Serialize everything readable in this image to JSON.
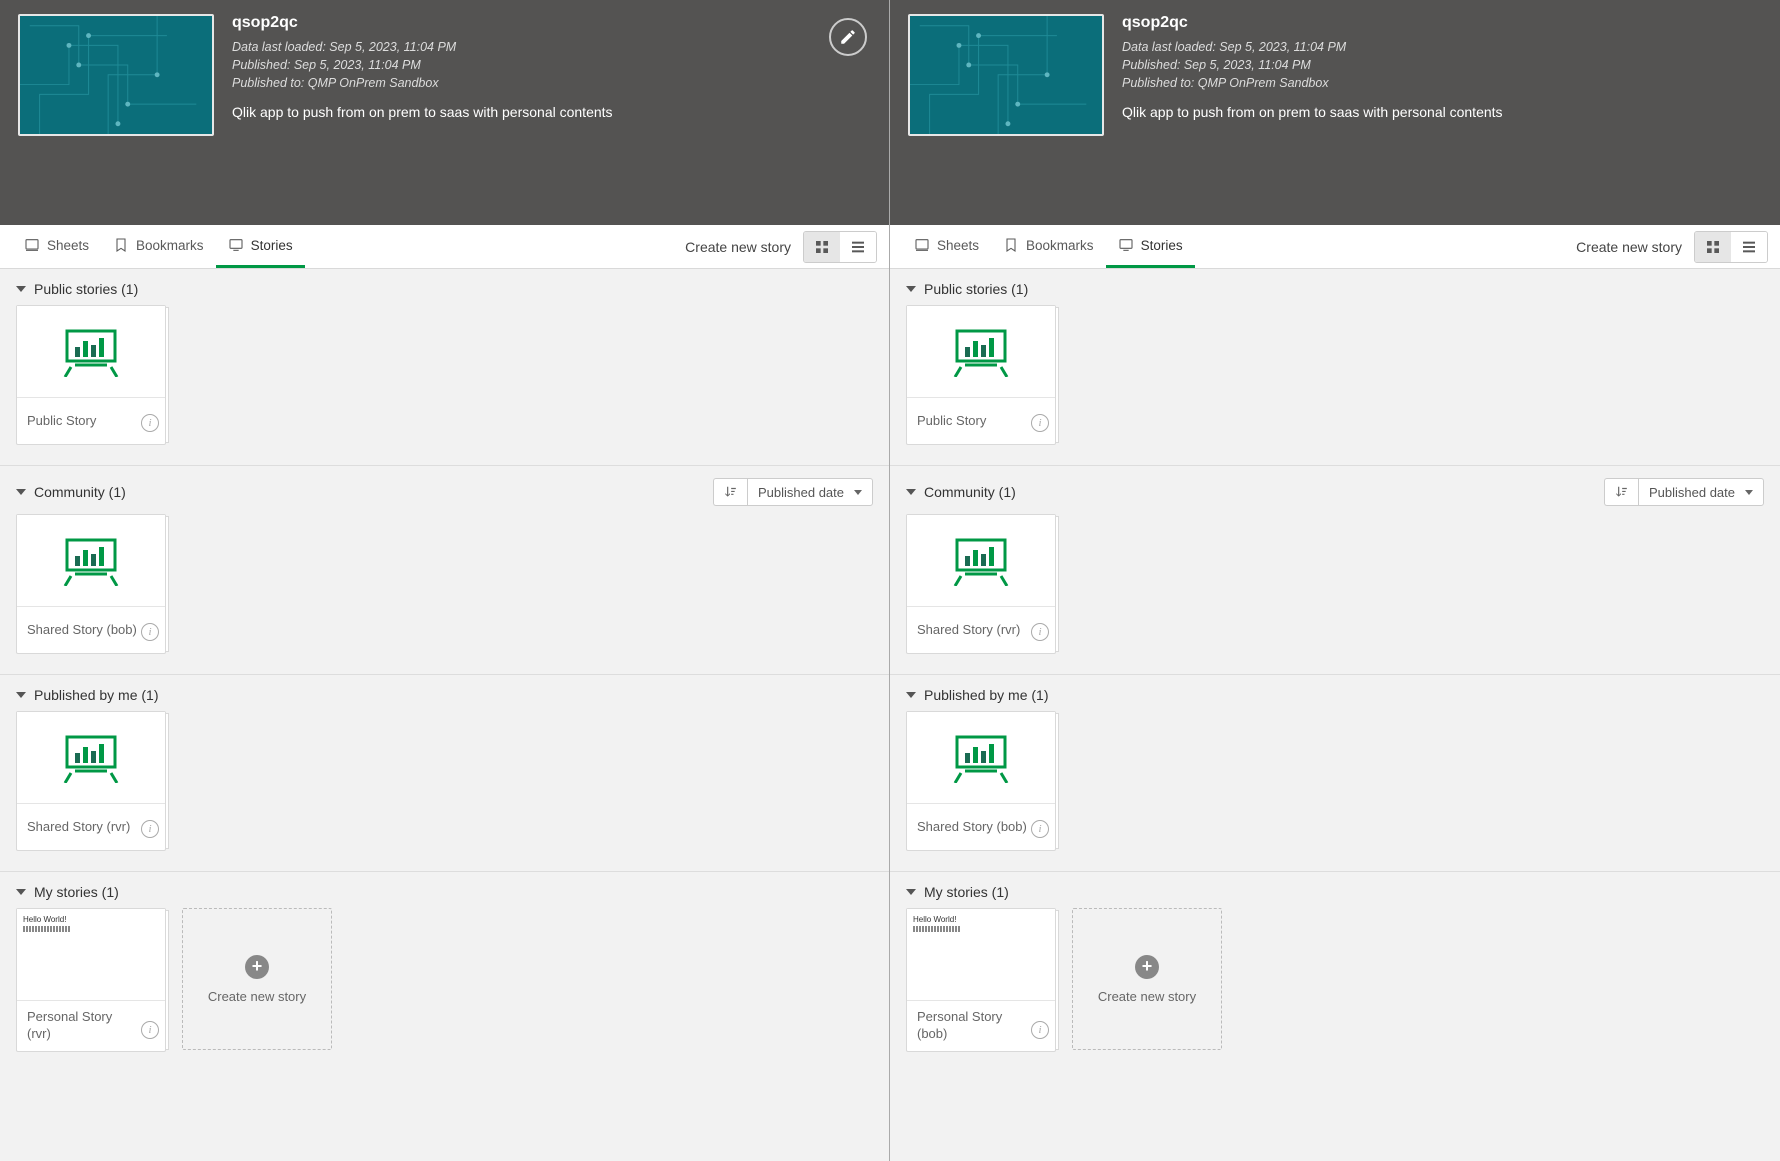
{
  "left": {
    "app": {
      "title": "qsop2qc",
      "loaded": "Data last loaded: Sep 5, 2023, 11:04 PM",
      "published": "Published: Sep 5, 2023, 11:04 PM",
      "published_to": "Published to: QMP OnPrem Sandbox",
      "desc": "Qlik app to push from on prem to saas with personal contents"
    },
    "tabs": {
      "sheets": "Sheets",
      "bookmarks": "Bookmarks",
      "stories": "Stories"
    },
    "create_link": "Create new story",
    "sort": {
      "label": "Published date"
    },
    "sections": {
      "public": {
        "title": "Public stories (1)",
        "items": [
          {
            "name": "Public Story"
          }
        ]
      },
      "community": {
        "title": "Community (1)",
        "items": [
          {
            "name": "Shared Story (bob)"
          }
        ]
      },
      "published_by_me": {
        "title": "Published by me (1)",
        "items": [
          {
            "name": "Shared Story (rvr)"
          }
        ]
      },
      "my_stories": {
        "title": "My stories (1)",
        "items": [
          {
            "name": "Personal Story (rvr)",
            "thumb_text": "Hello World!"
          }
        ]
      }
    },
    "new_card": "Create new story"
  },
  "right": {
    "app": {
      "title": "qsop2qc",
      "loaded": "Data last loaded: Sep 5, 2023, 11:04 PM",
      "published": "Published: Sep 5, 2023, 11:04 PM",
      "published_to": "Published to: QMP OnPrem Sandbox",
      "desc": "Qlik app to push from on prem to saas with personal contents"
    },
    "tabs": {
      "sheets": "Sheets",
      "bookmarks": "Bookmarks",
      "stories": "Stories"
    },
    "create_link": "Create new story",
    "sort": {
      "label": "Published date"
    },
    "sections": {
      "public": {
        "title": "Public stories (1)",
        "items": [
          {
            "name": "Public Story"
          }
        ]
      },
      "community": {
        "title": "Community (1)",
        "items": [
          {
            "name": "Shared Story (rvr)"
          }
        ]
      },
      "published_by_me": {
        "title": "Published by me (1)",
        "items": [
          {
            "name": "Shared Story (bob)"
          }
        ]
      },
      "my_stories": {
        "title": "My stories (1)",
        "items": [
          {
            "name": "Personal Story (bob)",
            "thumb_text": "Hello World!"
          }
        ]
      }
    },
    "new_card": "Create new story"
  }
}
